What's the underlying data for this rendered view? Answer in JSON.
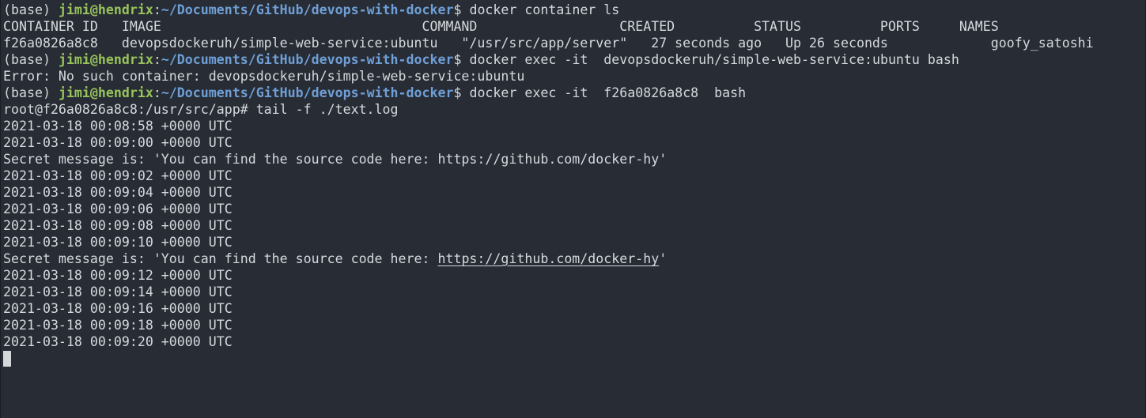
{
  "colors": {
    "background": "#272c35",
    "text": "#d6d9dc",
    "user": "#98c35a",
    "path": "#6f9fd6"
  },
  "prompt": {
    "env": "(base) ",
    "user": "jimi@hendrix",
    "colon": ":",
    "path": "~/Documents/GitHub/devops-with-docker",
    "symbol": "$ "
  },
  "commands": [
    "docker container ls",
    "docker exec -it  devopsdockeruh/simple-web-service:ubuntu bash",
    "docker exec -it  f26a0826a8c8  bash"
  ],
  "container_table": {
    "header": "CONTAINER ID   IMAGE                                 COMMAND                  CREATED          STATUS          PORTS     NAMES",
    "row": "f26a0826a8c8   devopsdockeruh/simple-web-service:ubuntu   \"/usr/src/app/server\"   27 seconds ago   Up 26 seconds             goofy_satoshi"
  },
  "error_line": "Error: No such container: devopsdockeruh/simple-web-service:ubuntu",
  "root_line": "root@f26a0826a8c8:/usr/src/app# tail -f ./text.log",
  "log": {
    "l1": "2021-03-18 00:08:58 +0000 UTC",
    "l2": "2021-03-18 00:09:00 +0000 UTC",
    "l3": "Secret message is: 'You can find the source code here: https://github.com/docker-hy'",
    "l4": "2021-03-18 00:09:02 +0000 UTC",
    "l5": "2021-03-18 00:09:04 +0000 UTC",
    "l6": "2021-03-18 00:09:06 +0000 UTC",
    "l7": "2021-03-18 00:09:08 +0000 UTC",
    "l8": "2021-03-18 00:09:10 +0000 UTC",
    "l9_prefix": "Secret message is: 'You can find the source code here: ",
    "l9_link": "https://github.com/docker-hy",
    "l9_suffix": "'",
    "l10": "2021-03-18 00:09:12 +0000 UTC",
    "l11": "2021-03-18 00:09:14 +0000 UTC",
    "l12": "2021-03-18 00:09:16 +0000 UTC",
    "l13": "2021-03-18 00:09:18 +0000 UTC",
    "l14": "2021-03-18 00:09:20 +0000 UTC"
  }
}
